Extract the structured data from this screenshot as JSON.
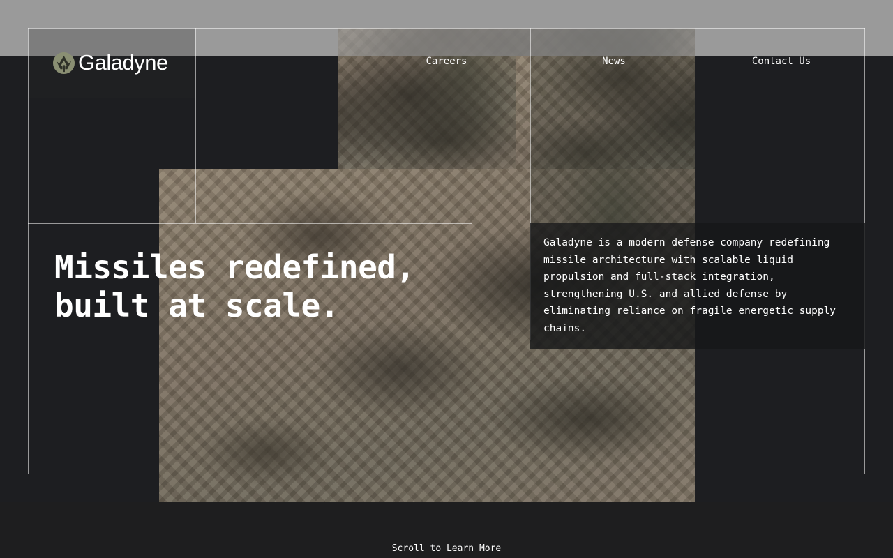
{
  "brand": {
    "name": "Galadyne",
    "logo_icon": "tree-mark-icon",
    "accent": "#8a8f73"
  },
  "nav": {
    "items": [
      {
        "label": "Careers"
      },
      {
        "label": "News"
      },
      {
        "label": "Contact Us"
      }
    ]
  },
  "hero": {
    "headline_line1": "Missiles redefined,",
    "headline_line2": "built at scale.",
    "description": "Galadyne is a modern defense company redefining missile architecture with scalable liquid propulsion and full-stack integration, strengthening U.S. and allied defense by eliminating reliance on fragile energetic supply chains."
  },
  "footer": {
    "scroll_hint": "Scroll to Learn More"
  },
  "colors": {
    "background": "#1d1e21",
    "top_band": "#9a9a9a",
    "text": "#ffffff"
  }
}
